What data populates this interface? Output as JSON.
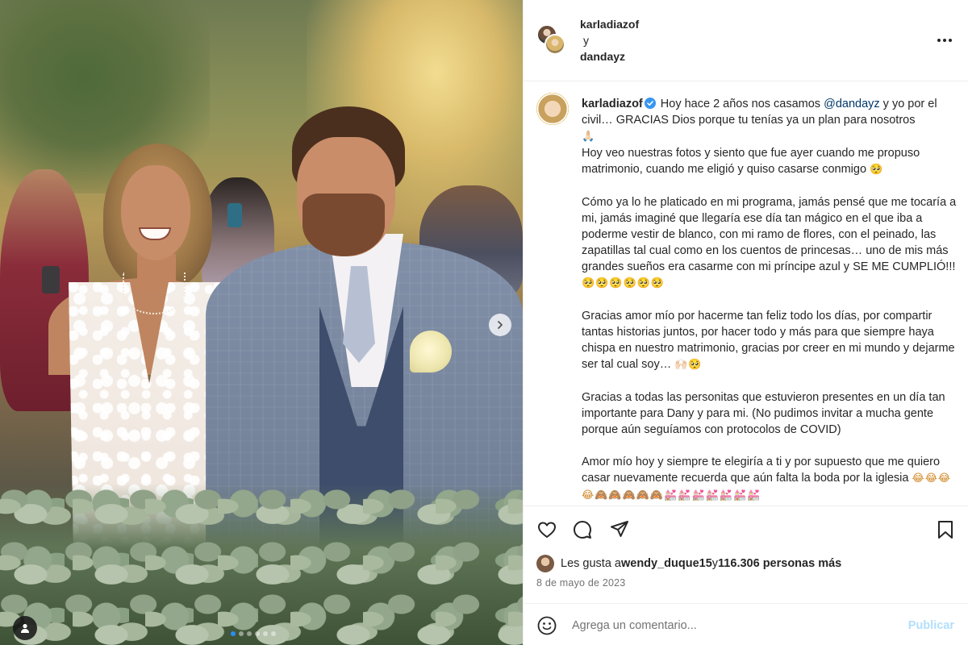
{
  "post": {
    "collab": {
      "user1": "karladiazof",
      "conjunction": "y",
      "user2": "dandayz"
    },
    "caption": {
      "username": "karladiazof",
      "verified": true,
      "p1_a": "Hoy hace 2 años nos casamos ",
      "mention": "@dandayz",
      "p1_b": " y yo por el civil… GRACIAS Dios porque tu tenías ya un plan para nosotros",
      "p1_emoji": "🙏🏻",
      "p2": "Hoy veo nuestras fotos y siento que fue ayer cuando me propuso matrimonio, cuando me eligió y quiso casarse conmigo ",
      "p2_emoji": "🥺",
      "p3": "Cómo ya lo he platicado en mi programa, jamás pensé que me tocaría a mi, jamás imaginé que llegaría ese día tan mágico en el que iba a poderme vestir de blanco, con mi ramo de flores, con el peinado, las zapatillas tal cual como en los cuentos de princesas… uno de mis más grandes sueños era casarme con mi príncipe azul y SE ME CUMPLIÓ!!! ",
      "p3_emoji": "🥺🥺🥺🥺🥺🥺",
      "p4": "Gracias amor mío por hacerme tan feliz todo los días, por compartir tantas historias juntos, por hacer todo y más para que siempre haya chispa en nuestro matrimonio, gracias por creer en mi mundo y dejarme ser tal cual soy… ",
      "p4_emoji": "🙌🏻🥺",
      "p5": "Gracias a todas las personitas que estuvieron presentes en un día tan importante para Dany y para mi. (No pudimos invitar a mucha gente porque aún seguíamos con protocolos de COVID)",
      "p6": "Amor mío hoy y siempre te elegiría a ti y por supuesto que me quiero casar nuevamente recuerda que aún falta la boda por la iglesia ",
      "p6_emoji": "😂😂😂😂🙈🙈🙈🙈🙈💒💒💒💒💒💒💒"
    },
    "likes": {
      "prefix": "Les gusta a ",
      "user": "wendy_duque15",
      "middle": " y ",
      "count": "116.306 personas más"
    },
    "date": "8 de mayo de 2023",
    "comment": {
      "placeholder": "Agrega un comentario...",
      "publish_label": "Publicar"
    },
    "carousel": {
      "total_slides": 6,
      "current_slide": 1
    }
  },
  "icons": {
    "more": "more-horizontal-icon",
    "like": "heart-icon",
    "comment": "comment-icon",
    "share": "send-icon",
    "save": "bookmark-icon",
    "emoji": "emoji-icon",
    "next": "chevron-right-icon",
    "tag": "user-tag-icon",
    "verified": "verified-badge-icon"
  },
  "colors": {
    "accent": "#0095f6",
    "publish_disabled": "#b2dffc",
    "mention": "#00376b",
    "verified": "#3897f0"
  }
}
